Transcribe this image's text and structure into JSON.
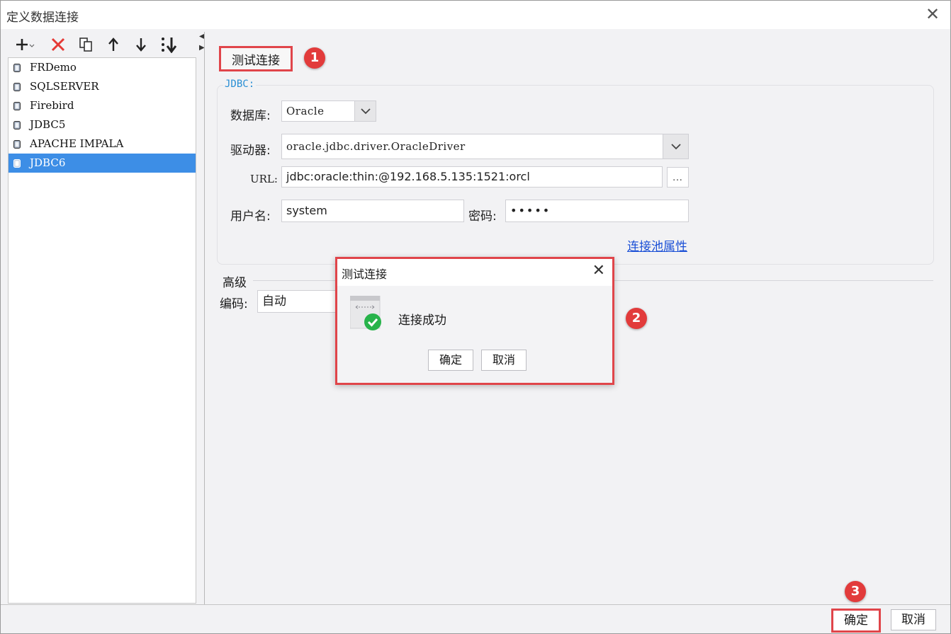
{
  "window": {
    "title": "定义数据连接"
  },
  "connections": {
    "items": [
      {
        "label": "FRDemo"
      },
      {
        "label": "SQLSERVER"
      },
      {
        "label": "Firebird"
      },
      {
        "label": "JDBC5"
      },
      {
        "label": "APACHE IMPALA"
      },
      {
        "label": "JDBC6",
        "selected": true
      }
    ]
  },
  "right": {
    "test_button": "测试连接",
    "group_title": "JDBC:",
    "database_label": "数据库:",
    "database_value": "Oracle",
    "driver_label": "驱动器:",
    "driver_value": "oracle.jdbc.driver.OracleDriver",
    "url_label": "URL:",
    "url_value": "jdbc:oracle:thin:@192.168.5.135:1521:orcl",
    "url_button": "...",
    "username_label": "用户名:",
    "username_value": "system",
    "password_label": "密码:",
    "password_value": "•••••",
    "pool_link": "连接池属性",
    "advanced_label": "高级",
    "encoding_label": "编码:",
    "encoding_value": "自动"
  },
  "dialog": {
    "title": "测试连接",
    "message": "连接成功",
    "ok": "确定",
    "cancel": "取消"
  },
  "footer": {
    "ok": "确定",
    "cancel": "取消"
  },
  "badges": [
    "1",
    "2",
    "3"
  ],
  "colors": {
    "highlight": "#e0454a",
    "selection": "#3d8ee6",
    "link": "#1a4fd6",
    "badge": "#e23b3b",
    "success": "#27b34a"
  }
}
